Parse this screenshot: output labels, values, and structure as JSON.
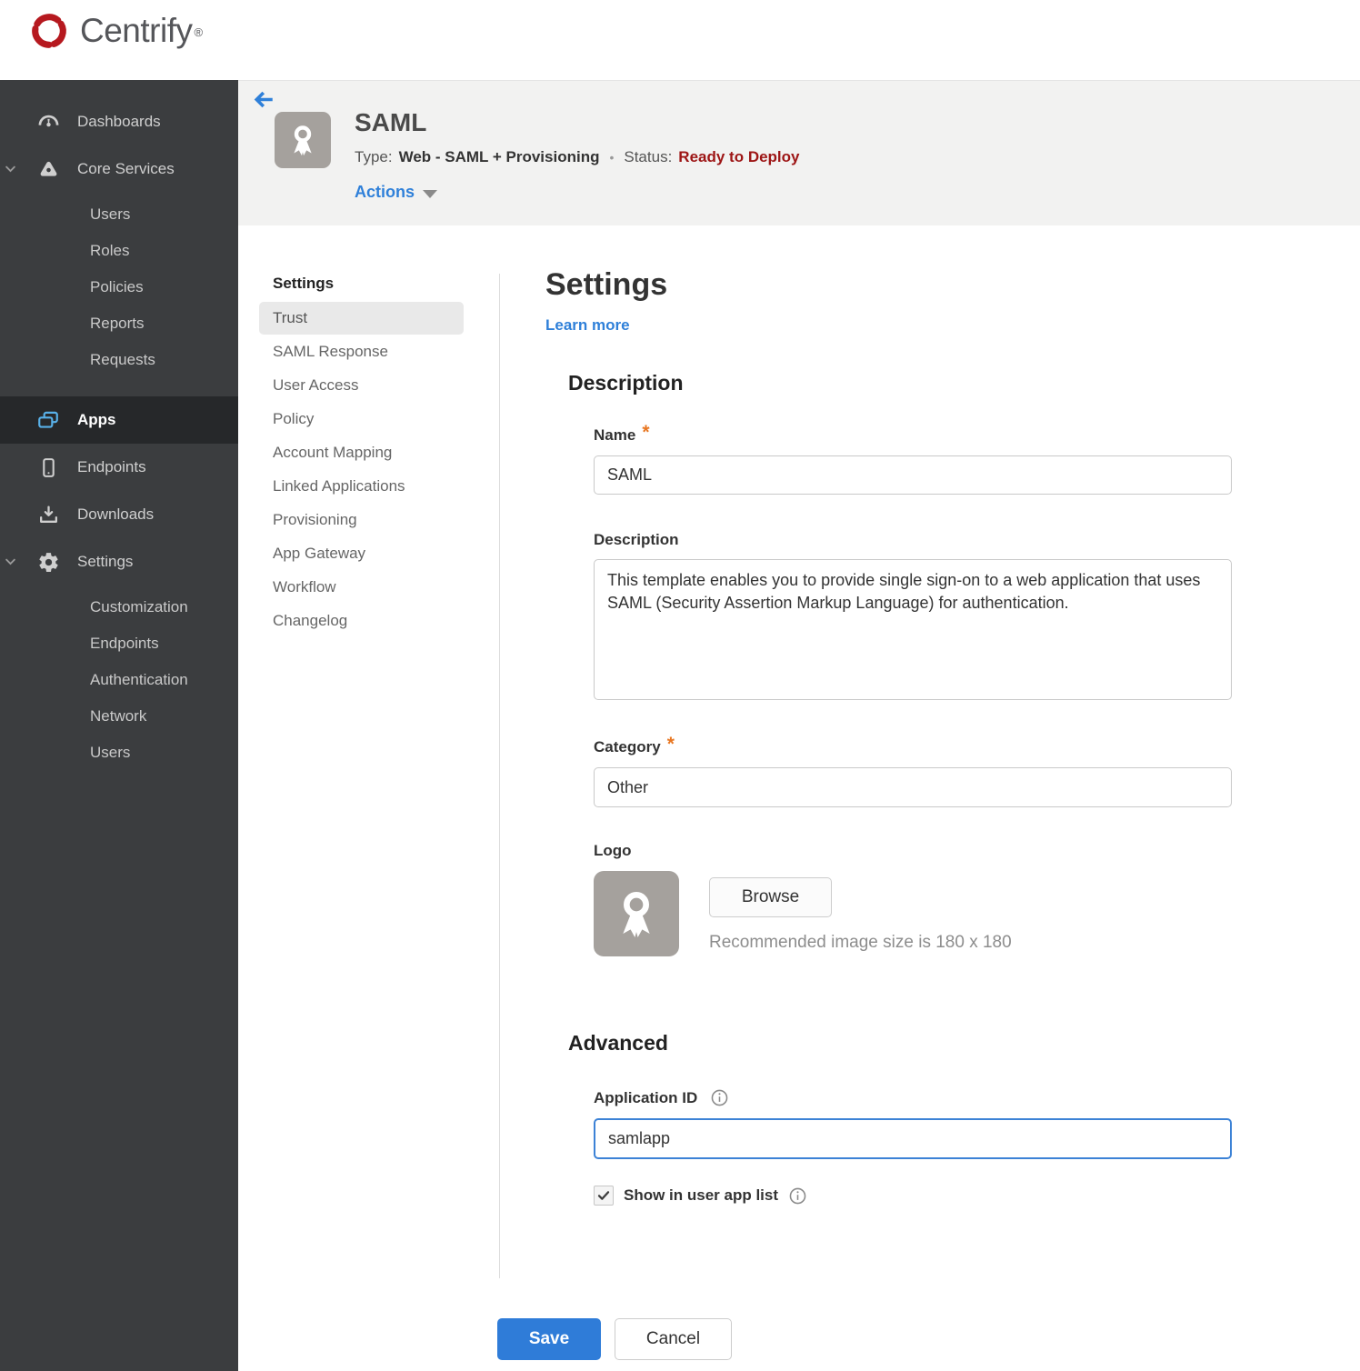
{
  "brand": {
    "name": "Centrify",
    "registered": "®"
  },
  "sidebar": {
    "items": [
      {
        "label": "Dashboards"
      },
      {
        "label": "Core Services",
        "expanded": true,
        "children": [
          {
            "label": "Users"
          },
          {
            "label": "Roles"
          },
          {
            "label": "Policies"
          },
          {
            "label": "Reports"
          },
          {
            "label": "Requests"
          }
        ]
      },
      {
        "label": "Apps",
        "active": true
      },
      {
        "label": "Endpoints"
      },
      {
        "label": "Downloads"
      },
      {
        "label": "Settings",
        "expanded": true,
        "children": [
          {
            "label": "Customization"
          },
          {
            "label": "Endpoints"
          },
          {
            "label": "Authentication"
          },
          {
            "label": "Network"
          },
          {
            "label": "Users"
          }
        ]
      }
    ]
  },
  "header": {
    "title": "SAML",
    "type_label": "Type:",
    "type_value": "Web - SAML + Provisioning",
    "separator": "•",
    "status_label": "Status:",
    "status_value": "Ready to Deploy",
    "actions_label": "Actions"
  },
  "subnav": {
    "heading": "Settings",
    "items": [
      {
        "label": "Trust",
        "active": true
      },
      {
        "label": "SAML Response"
      },
      {
        "label": "User Access"
      },
      {
        "label": "Policy"
      },
      {
        "label": "Account Mapping"
      },
      {
        "label": "Linked Applications"
      },
      {
        "label": "Provisioning"
      },
      {
        "label": "App Gateway"
      },
      {
        "label": "Workflow"
      },
      {
        "label": "Changelog"
      }
    ]
  },
  "main": {
    "title": "Settings",
    "learn_more": "Learn more",
    "required_marker": "*",
    "description_section": {
      "heading": "Description",
      "name_label": "Name",
      "name_value": "SAML",
      "description_label": "Description",
      "description_value": "This template enables you to provide single sign-on to a web application that uses SAML (Security Assertion Markup Language) for authentication.",
      "category_label": "Category",
      "category_value": "Other",
      "logo_label": "Logo",
      "browse_button": "Browse",
      "logo_hint": "Recommended image size is 180 x 180"
    },
    "advanced_section": {
      "heading": "Advanced",
      "application_id_label": "Application ID",
      "application_id_value": "samlapp",
      "show_in_app_list_label": "Show in user app list",
      "checkbox_checked": true
    },
    "save_button": "Save",
    "cancel_button": "Cancel"
  },
  "colors": {
    "accent_blue": "#2f80d9",
    "save_blue": "#2f7cd8",
    "status_red": "#9d1515",
    "required_orange": "#e87722",
    "brand_red": "#b6191f",
    "sidebar_bg": "#3b3d3f",
    "sidebar_active_bg": "#26282a",
    "header_bg": "#f2f2f1"
  }
}
